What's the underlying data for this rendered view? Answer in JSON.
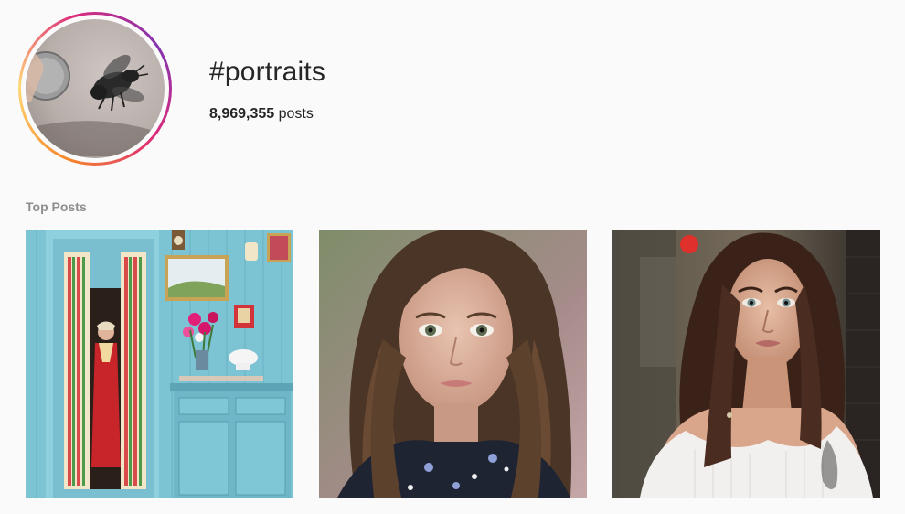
{
  "header": {
    "hashtag": "#portraits",
    "post_count": "8,969,355",
    "post_count_suffix": " posts"
  },
  "section": {
    "title": "Top Posts"
  },
  "posts": [
    {
      "subject": "woman-in-doorway-photo"
    },
    {
      "subject": "girl-portrait-photo"
    },
    {
      "subject": "woman-portrait-photo"
    }
  ]
}
